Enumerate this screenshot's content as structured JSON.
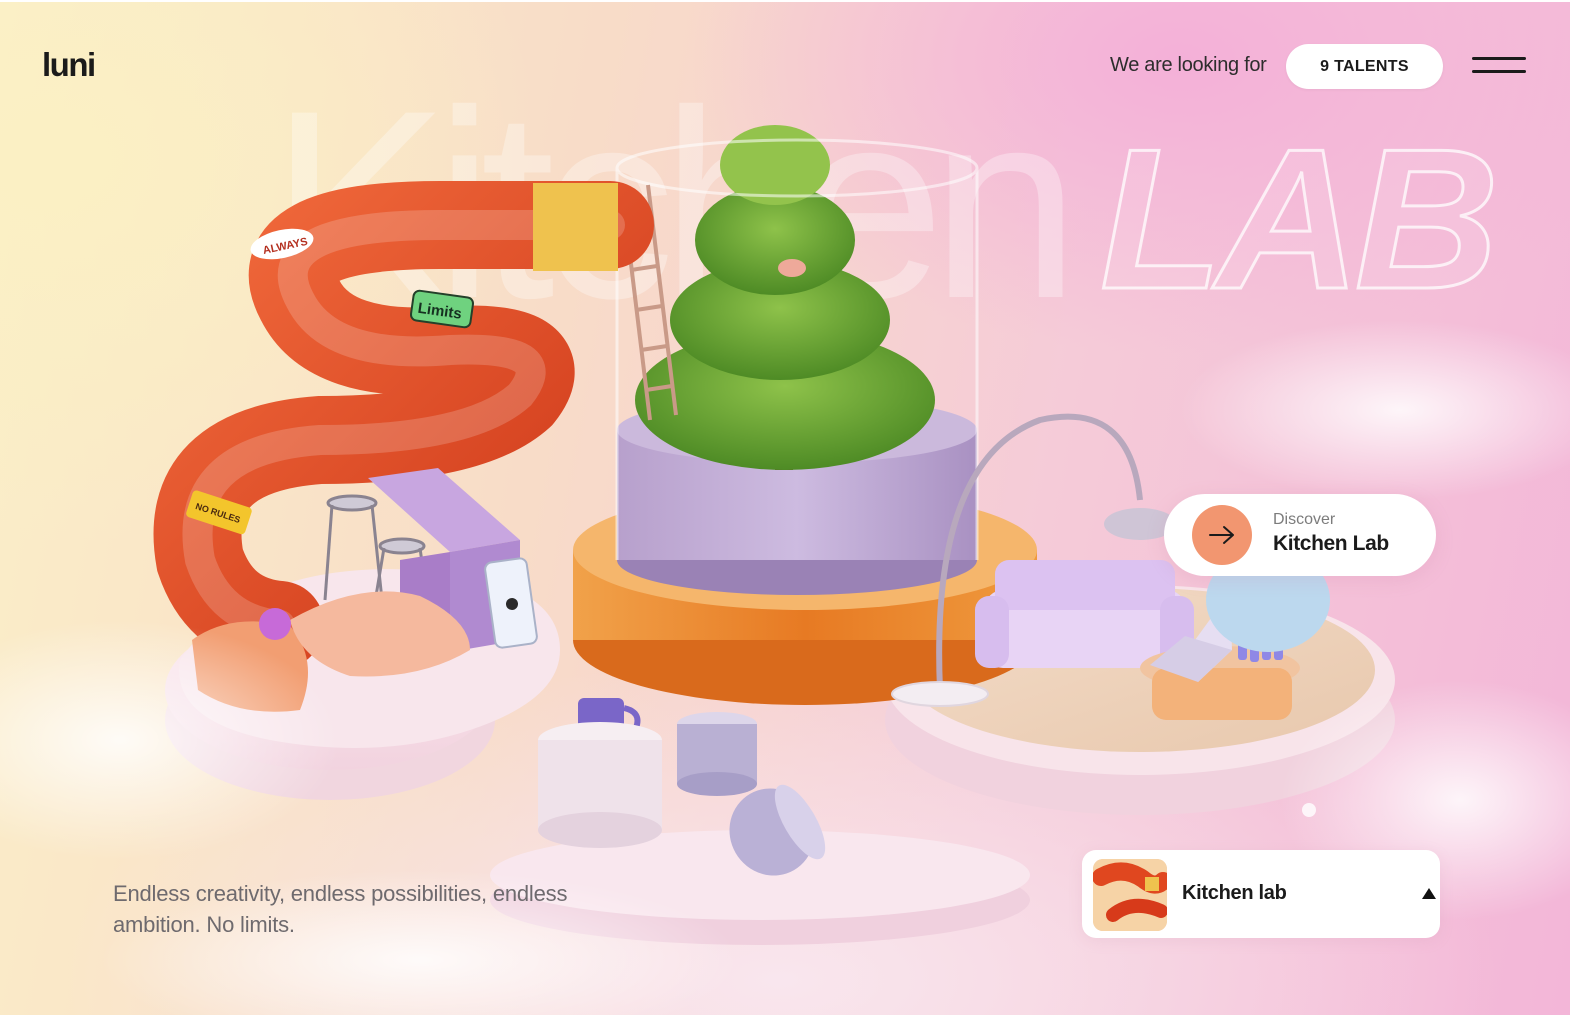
{
  "brand": {
    "logo": "luni"
  },
  "header": {
    "looking_text": "We are looking for",
    "talents_button": "9 TALENTS",
    "menu_icon": "hamburger-menu-icon"
  },
  "hero": {
    "title_word": "Kitchen",
    "title_graffiti": "LAB",
    "sticker_text": "Limits",
    "sticker_top": "No",
    "slide_labels": [
      "ALWAYS",
      "NO RULES"
    ]
  },
  "cta": {
    "eyebrow": "Discover",
    "title": "Kitchen Lab",
    "icon": "arrow-right-icon",
    "accent_color": "#f29670"
  },
  "tagline": "Endless creativity, endless possibilities, endless ambition. No limits.",
  "project_selector": {
    "label": "Kitchen lab",
    "icon": "caret-up-icon"
  }
}
